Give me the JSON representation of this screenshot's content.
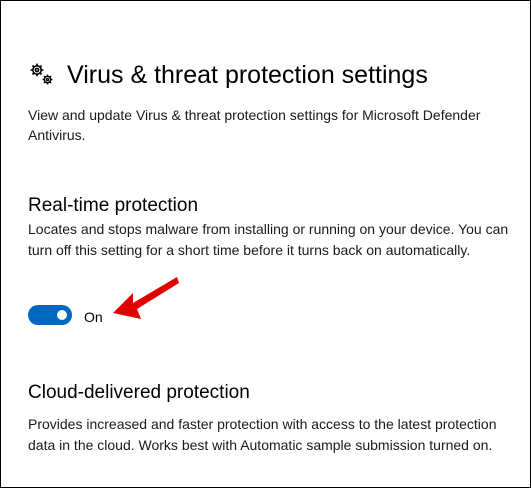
{
  "page": {
    "title": "Virus & threat protection settings",
    "description": "View and update Virus & threat protection settings for Microsoft Defender Antivirus.",
    "title_icon": "gears-icon"
  },
  "sections": [
    {
      "title": "Real-time protection",
      "description": "Locates and stops malware from installing or running on your device. You can turn off this setting for a short time before it turns back on automatically.",
      "toggle": {
        "state": "on",
        "label": "On"
      }
    },
    {
      "title": "Cloud-delivered protection",
      "description": "Provides increased and faster protection with access to the latest protection data in the cloud. Works best with Automatic sample submission turned on."
    }
  ],
  "colors": {
    "accent": "#0067c0",
    "annotation_arrow": "#e00000",
    "text": "#000000",
    "background": "#ffffff"
  },
  "annotation": {
    "icon": "red-arrow-icon"
  }
}
